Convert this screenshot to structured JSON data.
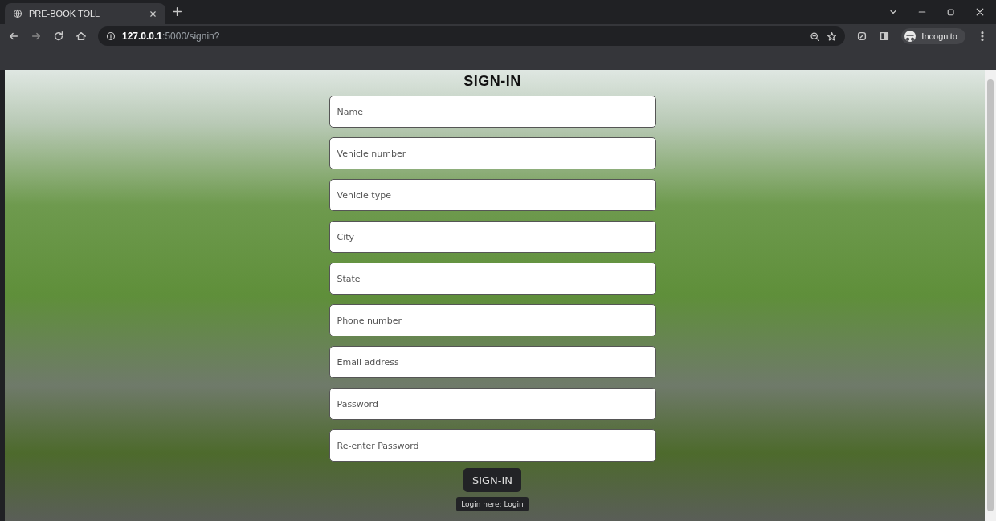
{
  "browser": {
    "tab": {
      "title": "PRE-BOOK TOLL",
      "selected": true
    },
    "address": {
      "host": "127.0.0.1",
      "path": ":5000/signin?"
    },
    "profile": "Incognito"
  },
  "form": {
    "title": "SIGN-IN",
    "fields": [
      {
        "placeholder": "Name"
      },
      {
        "placeholder": "Vehicle number"
      },
      {
        "placeholder": "Vehicle type"
      },
      {
        "placeholder": "City"
      },
      {
        "placeholder": "State"
      },
      {
        "placeholder": "Phone number"
      },
      {
        "placeholder": "Email address"
      },
      {
        "placeholder": "Password"
      },
      {
        "placeholder": "Re-enter Password"
      }
    ],
    "submit": "SIGN-IN",
    "login_link": "Login here: Login"
  }
}
